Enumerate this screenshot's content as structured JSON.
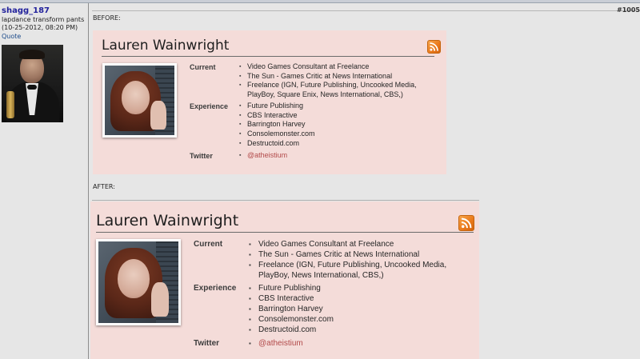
{
  "post": {
    "number": "#1005",
    "before_label": "BEFORE:",
    "after_label": "AFTER:"
  },
  "user": {
    "name": "shagg_187",
    "title": "lapdance transform pants",
    "date": "(10-25-2012, 08:20 PM)",
    "quote_label": "Quote"
  },
  "profile": {
    "name": "Lauren Wainwright",
    "current_label": "Current",
    "current": [
      "Video Games Consultant at Freelance",
      "The Sun - Games Critic at News International",
      "Freelance (IGN, Future Publishing, Uncooked Media, PlayBoy, Square Enix, News International, CBS,)"
    ],
    "current_after": [
      "Video Games Consultant at Freelance",
      "The Sun - Games Critic at News International",
      "Freelance (IGN, Future Publishing, Uncooked Media, PlayBoy, News International, CBS,)"
    ],
    "experience_label": "Experience",
    "experience": [
      "Future Publishing",
      "CBS Interactive",
      "Barrington Harvey",
      "Consolemonster.com",
      "Destructoid.com"
    ],
    "twitter_label": "Twitter",
    "twitter": "@atheistium"
  },
  "icons": {
    "rss": "rss-feed-icon",
    "bullet": "square-bullet"
  },
  "colors": {
    "card_bg": "#f4dcd9",
    "username": "#22229c",
    "twitter_link": "#b24a4a",
    "rss": "#e9781a"
  }
}
